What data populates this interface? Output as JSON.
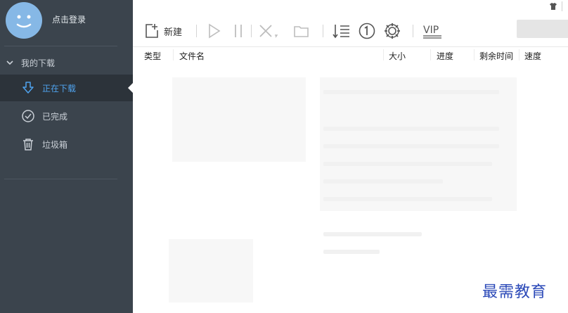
{
  "sidebar": {
    "login_label": "点击登录",
    "section_label": "我的下载",
    "items": [
      {
        "label": "正在下载",
        "icon": "download-arrow-icon",
        "active": true
      },
      {
        "label": "已完成",
        "icon": "check-circle-icon",
        "active": false
      },
      {
        "label": "垃圾箱",
        "icon": "trash-icon",
        "active": false
      }
    ]
  },
  "toolbar": {
    "new_label": "新建",
    "vip_label": "VIP",
    "icons": [
      "new-file-icon",
      "play-icon",
      "pause-icon",
      "delete-icon",
      "folder-icon",
      "sort-list-icon",
      "limit-one-icon",
      "settings-gear-icon",
      "vip-icon"
    ]
  },
  "table": {
    "columns": [
      "类型",
      "文件名",
      "大小",
      "进度",
      "剩余时间",
      "速度"
    ]
  },
  "watermark": "最需教育",
  "colors": {
    "sidebar_bg": "#3b444d",
    "active_bg": "#2c333a",
    "accent": "#4fa3ee",
    "avatar": "#86b8e6"
  }
}
